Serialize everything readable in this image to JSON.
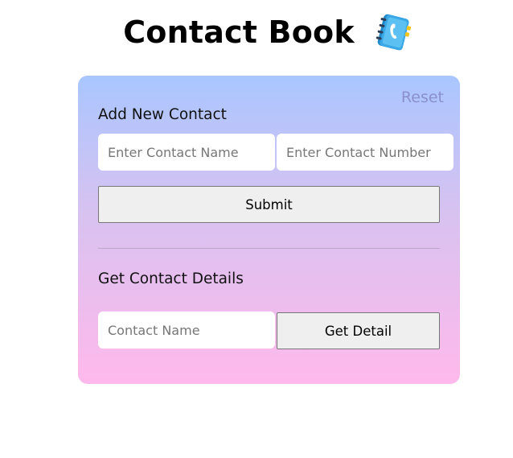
{
  "header": {
    "title": "Contact Book",
    "icon": "contact-book-icon"
  },
  "card": {
    "reset_label": "Reset",
    "add_section": {
      "title": "Add New Contact",
      "name_placeholder": "Enter Contact Name",
      "number_placeholder": "Enter Contact Number",
      "submit_label": "Submit"
    },
    "get_section": {
      "title": "Get Contact Details",
      "lookup_placeholder": "Contact Name",
      "get_detail_label": "Get Detail"
    }
  },
  "colors": {
    "gradient_top": "#a9c6ff",
    "gradient_bottom": "#ffb9ec",
    "reset_text": "#8b8fce",
    "button_bg": "#efefef"
  }
}
